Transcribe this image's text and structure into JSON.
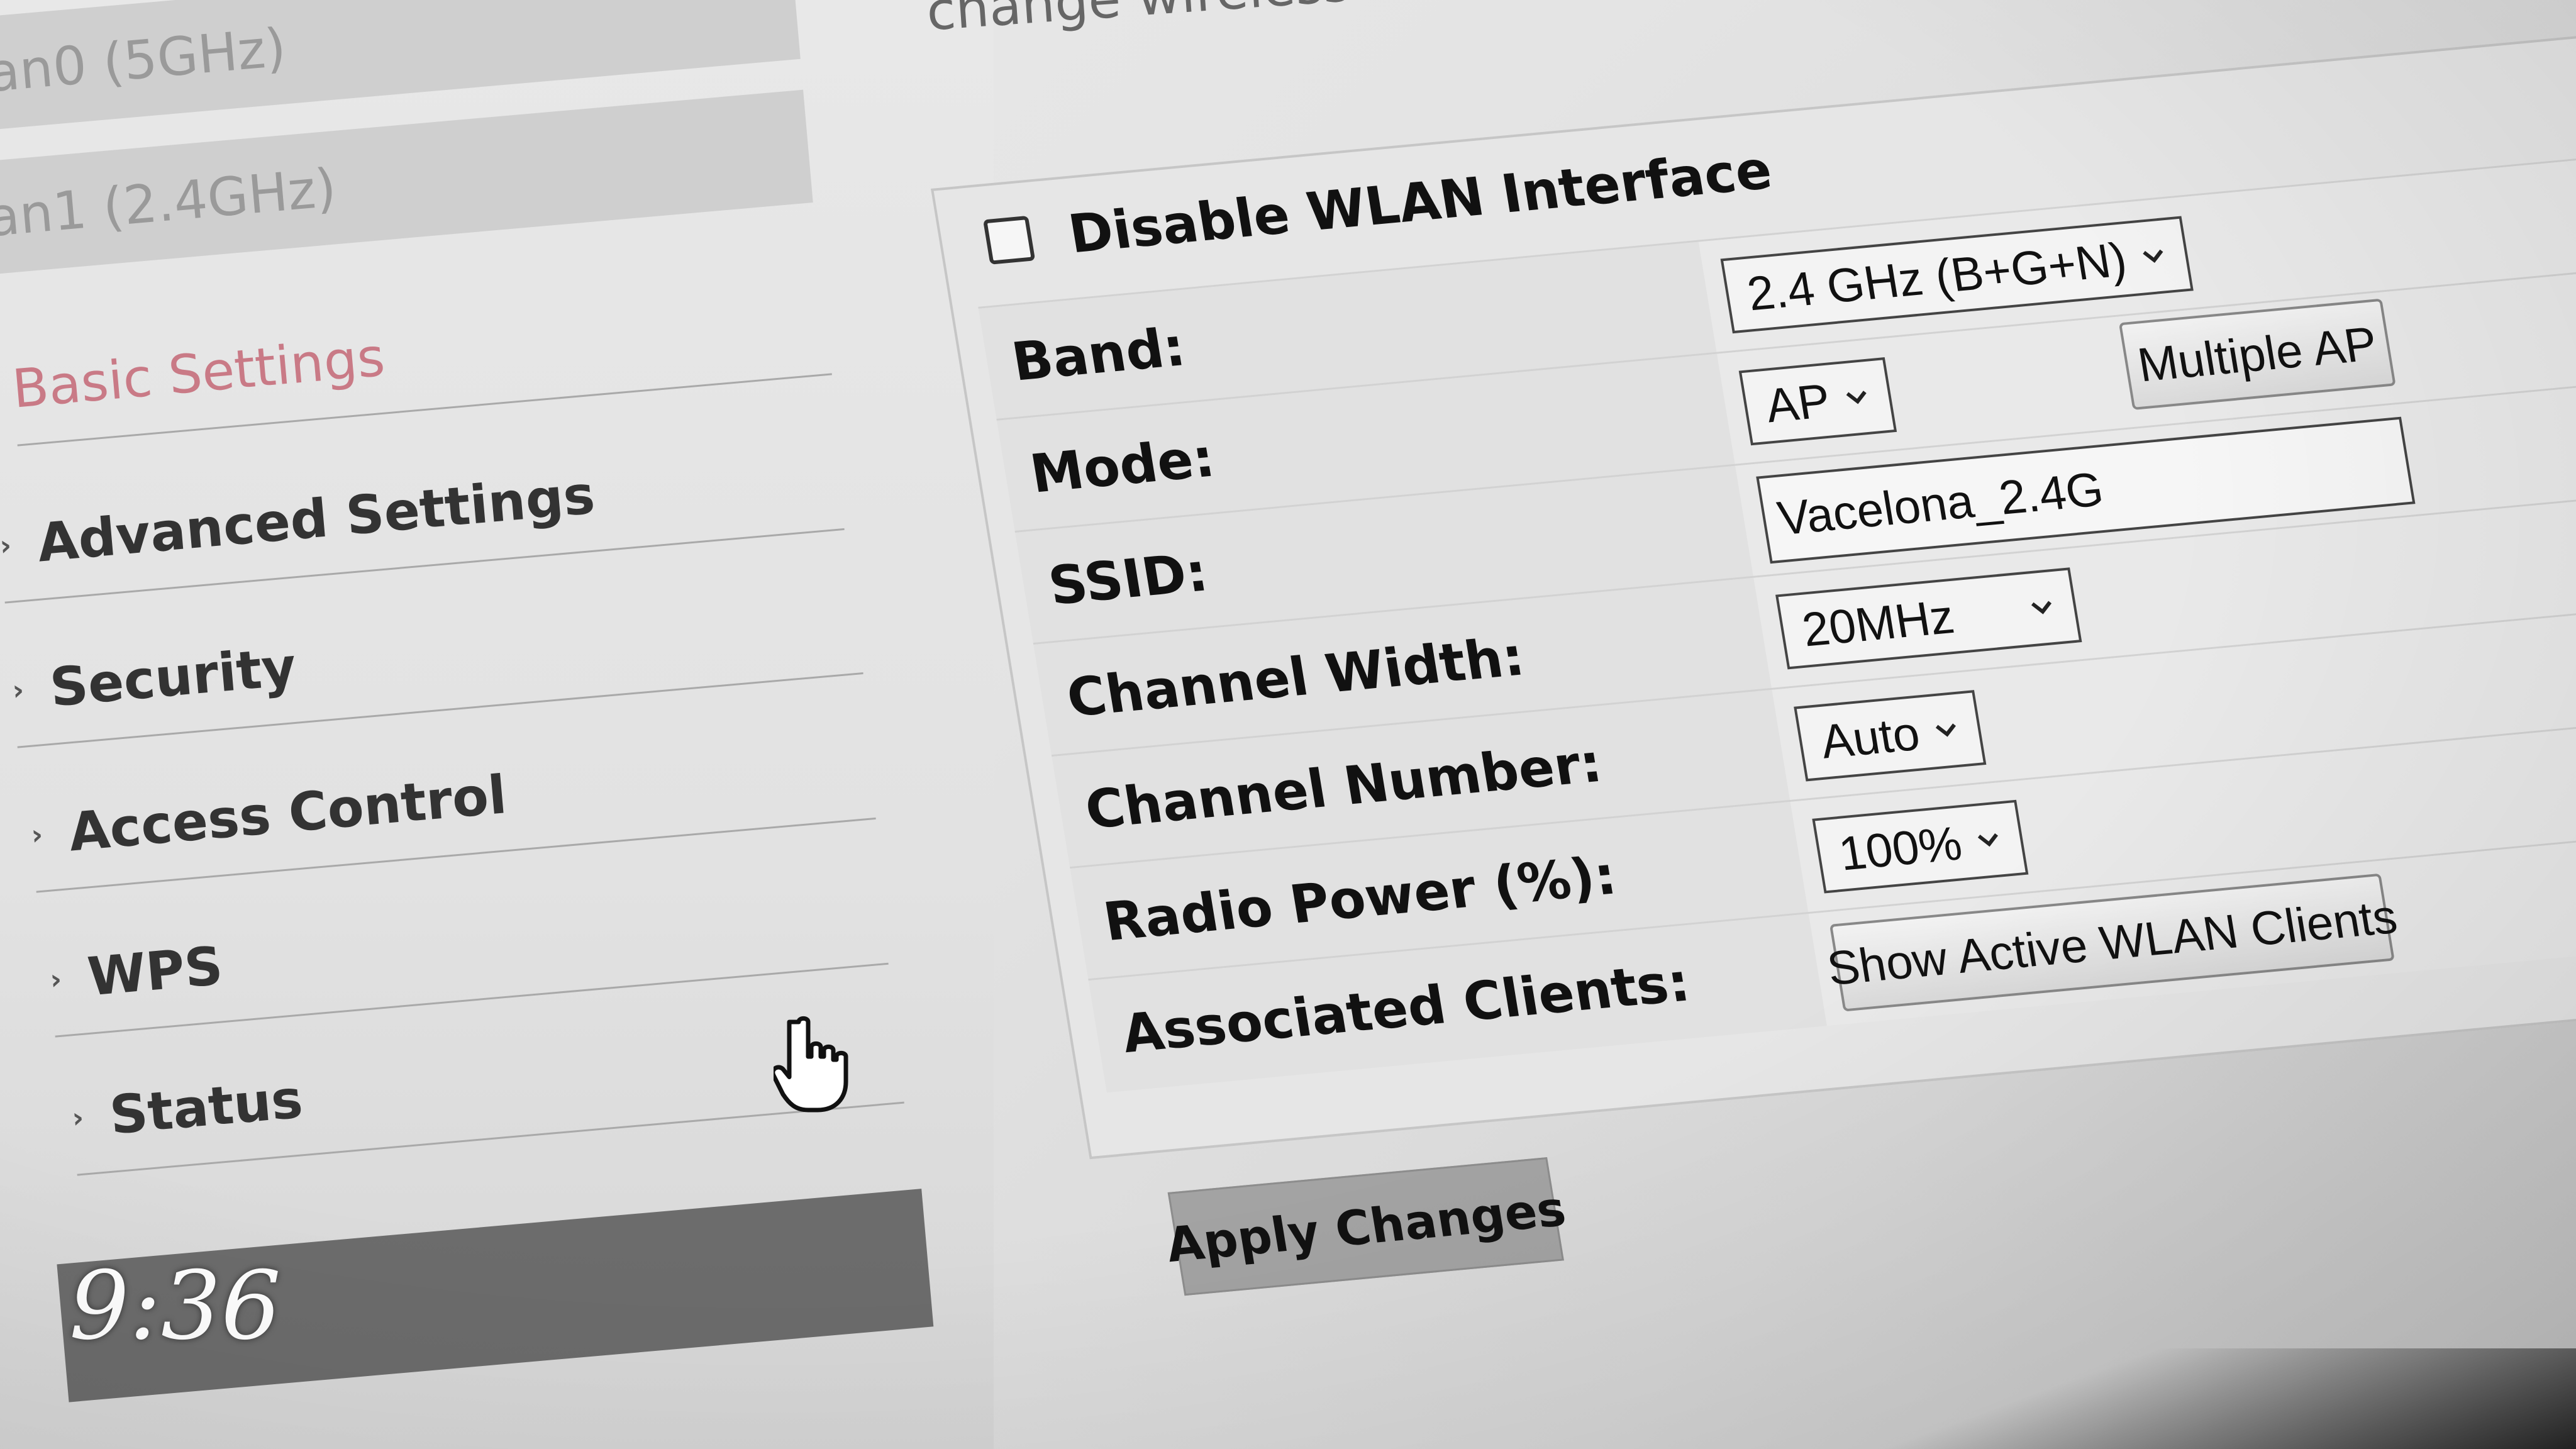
{
  "page": {
    "heading": "change wireless basic setting"
  },
  "sidebar": {
    "items": [
      {
        "label": "an0 (5GHz)"
      },
      {
        "label": "an1 (2.4GHz)"
      },
      {
        "label": "Basic Settings"
      },
      {
        "label": "Advanced Settings"
      },
      {
        "label": "Security"
      },
      {
        "label": "Access Control"
      },
      {
        "label": "WPS"
      },
      {
        "label": "Status"
      }
    ],
    "arrow_glyph": "›"
  },
  "form": {
    "disable_wlan_label": "Disable WLAN Interface",
    "disable_wlan_checked": false,
    "band": {
      "label": "Band:",
      "value": "2.4 GHz (B+G+N)"
    },
    "mode": {
      "label": "Mode:",
      "value": "AP",
      "multiple_ap_button": "Multiple AP"
    },
    "ssid": {
      "label": "SSID:",
      "value": "Vacelona_2.4G"
    },
    "channel_width": {
      "label": "Channel Width:",
      "value": "20MHz"
    },
    "channel_number": {
      "label": "Channel Number:",
      "value": "Auto"
    },
    "radio_power": {
      "label": "Radio Power (%):",
      "value": "100%"
    },
    "associated_clients": {
      "label": "Associated Clients:",
      "button": "Show Active WLAN Clients"
    },
    "apply_button": "Apply Changes"
  },
  "overlay": {
    "time": "9:36"
  },
  "icons": {
    "chevron": "chevron-down-icon",
    "cursor": "hand-pointer-icon",
    "checkbox": "checkbox-unchecked-icon"
  },
  "colors": {
    "active_nav": "#c97a86",
    "panel_bg": "#e6e6e6",
    "apply_bg": "#a3a3a3"
  }
}
